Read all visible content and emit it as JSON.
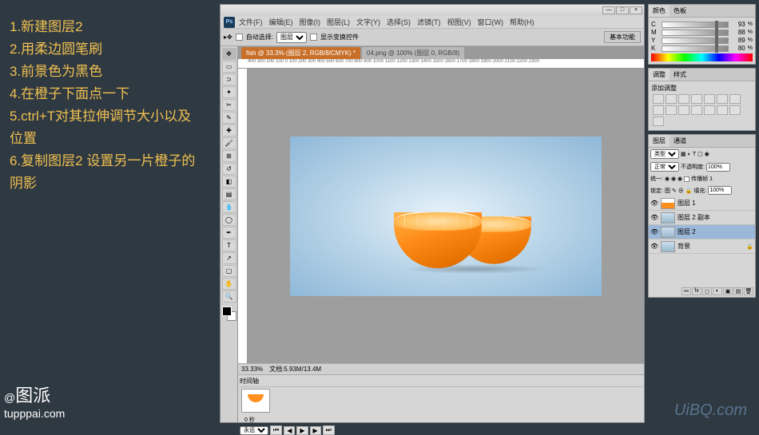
{
  "instructions": {
    "line1": "1.新建图层2",
    "line2": "2.用柔边圆笔刷",
    "line3": "3.前景色为黑色",
    "line4": "4.在橙子下面点一下",
    "line5": "5.ctrl+T对其拉伸调节大小以及位置",
    "line6": "6.复制图层2 设置另一片橙子的阴影"
  },
  "logo": {
    "at": "@",
    "name": "图派",
    "url": "tupppai.com"
  },
  "watermark": "UiBQ.com",
  "titlebar": {
    "min": "—",
    "max": "□",
    "close": "×"
  },
  "menu": {
    "ps": "Ps",
    "file": "文件(F)",
    "edit": "编辑(E)",
    "image": "图像(I)",
    "layer": "图层(L)",
    "type": "文字(Y)",
    "select": "选择(S)",
    "filter": "滤镜(T)",
    "view": "视图(V)",
    "window": "窗口(W)",
    "help": "帮助(H)"
  },
  "options": {
    "auto_select": "自动选择:",
    "group": "图层",
    "show_transform": "显示变换控件",
    "essentials": "基本功能"
  },
  "doctabs": {
    "tab1": "fish @ 33.3% (图层 2, RGB/8/CMYK) *",
    "tab2": "04.png @ 100% (图层 0, RGB/8)"
  },
  "ruler": "400   300   200   100   0   100   200   300   400   500   600   700   800   900   1000  1100  1200  1300  1400  1500  1600  1700  1800  1900  2000  2100  2200  2300",
  "status": {
    "zoom": "33.33%",
    "docsize": "文档:5.93M/13.4M"
  },
  "anim": {
    "title": "时间轴",
    "duration": "0 秒",
    "loop": "永远"
  },
  "color_panel": {
    "tab1": "颜色",
    "tab2": "色板",
    "c": {
      "lbl": "C",
      "val": "93",
      "pct": "%"
    },
    "m": {
      "lbl": "M",
      "val": "88",
      "pct": "%"
    },
    "y": {
      "lbl": "Y",
      "val": "89",
      "pct": "%"
    },
    "k": {
      "lbl": "K",
      "val": "80",
      "pct": "%"
    }
  },
  "adjust_panel": {
    "tab1": "调整",
    "tab2": "样式",
    "hint": "添加调整"
  },
  "layers_panel": {
    "tab1": "图层",
    "tab2": "通道",
    "kind": "类型",
    "mode": "正常",
    "opacity_lbl": "不透明度:",
    "opacity": "100%",
    "lock_lbl": "锁定:",
    "lock_icons": "图 ✎ ⊕ 🔒",
    "fill_lbl": "填充:",
    "fill": "100%",
    "uni_lbl": "统一:",
    "prop_lbl": "传播帧 1",
    "layers": [
      {
        "name": "图层 1"
      },
      {
        "name": "图层 2 副本"
      },
      {
        "name": "图层 2"
      },
      {
        "name": "背景"
      }
    ]
  }
}
